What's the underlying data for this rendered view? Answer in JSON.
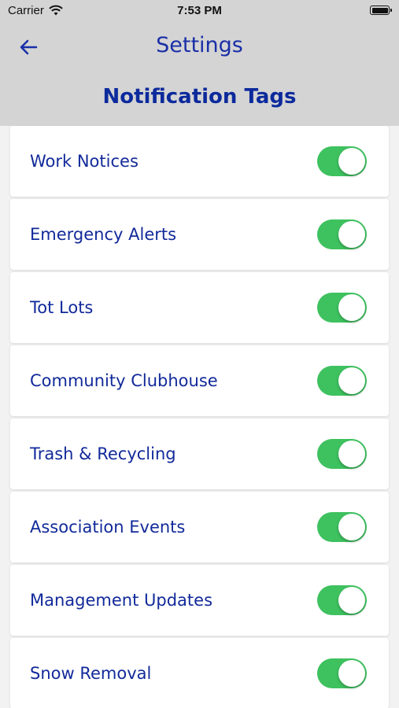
{
  "status_bar": {
    "carrier": "Carrier",
    "time": "7:53 PM"
  },
  "nav": {
    "back_icon": "arrow-left-icon",
    "title": "Settings"
  },
  "section_title": "Notification Tags",
  "colors": {
    "accent": "#1a2fa8",
    "toggle_on": "#3ec15f",
    "header_bg": "#d4d4d4"
  },
  "tags": [
    {
      "label": "Work Notices",
      "enabled": true
    },
    {
      "label": "Emergency Alerts",
      "enabled": true
    },
    {
      "label": "Tot Lots",
      "enabled": true
    },
    {
      "label": "Community Clubhouse",
      "enabled": true
    },
    {
      "label": "Trash & Recycling",
      "enabled": true
    },
    {
      "label": "Association Events",
      "enabled": true
    },
    {
      "label": "Management Updates",
      "enabled": true
    },
    {
      "label": "Snow Removal",
      "enabled": true
    }
  ]
}
